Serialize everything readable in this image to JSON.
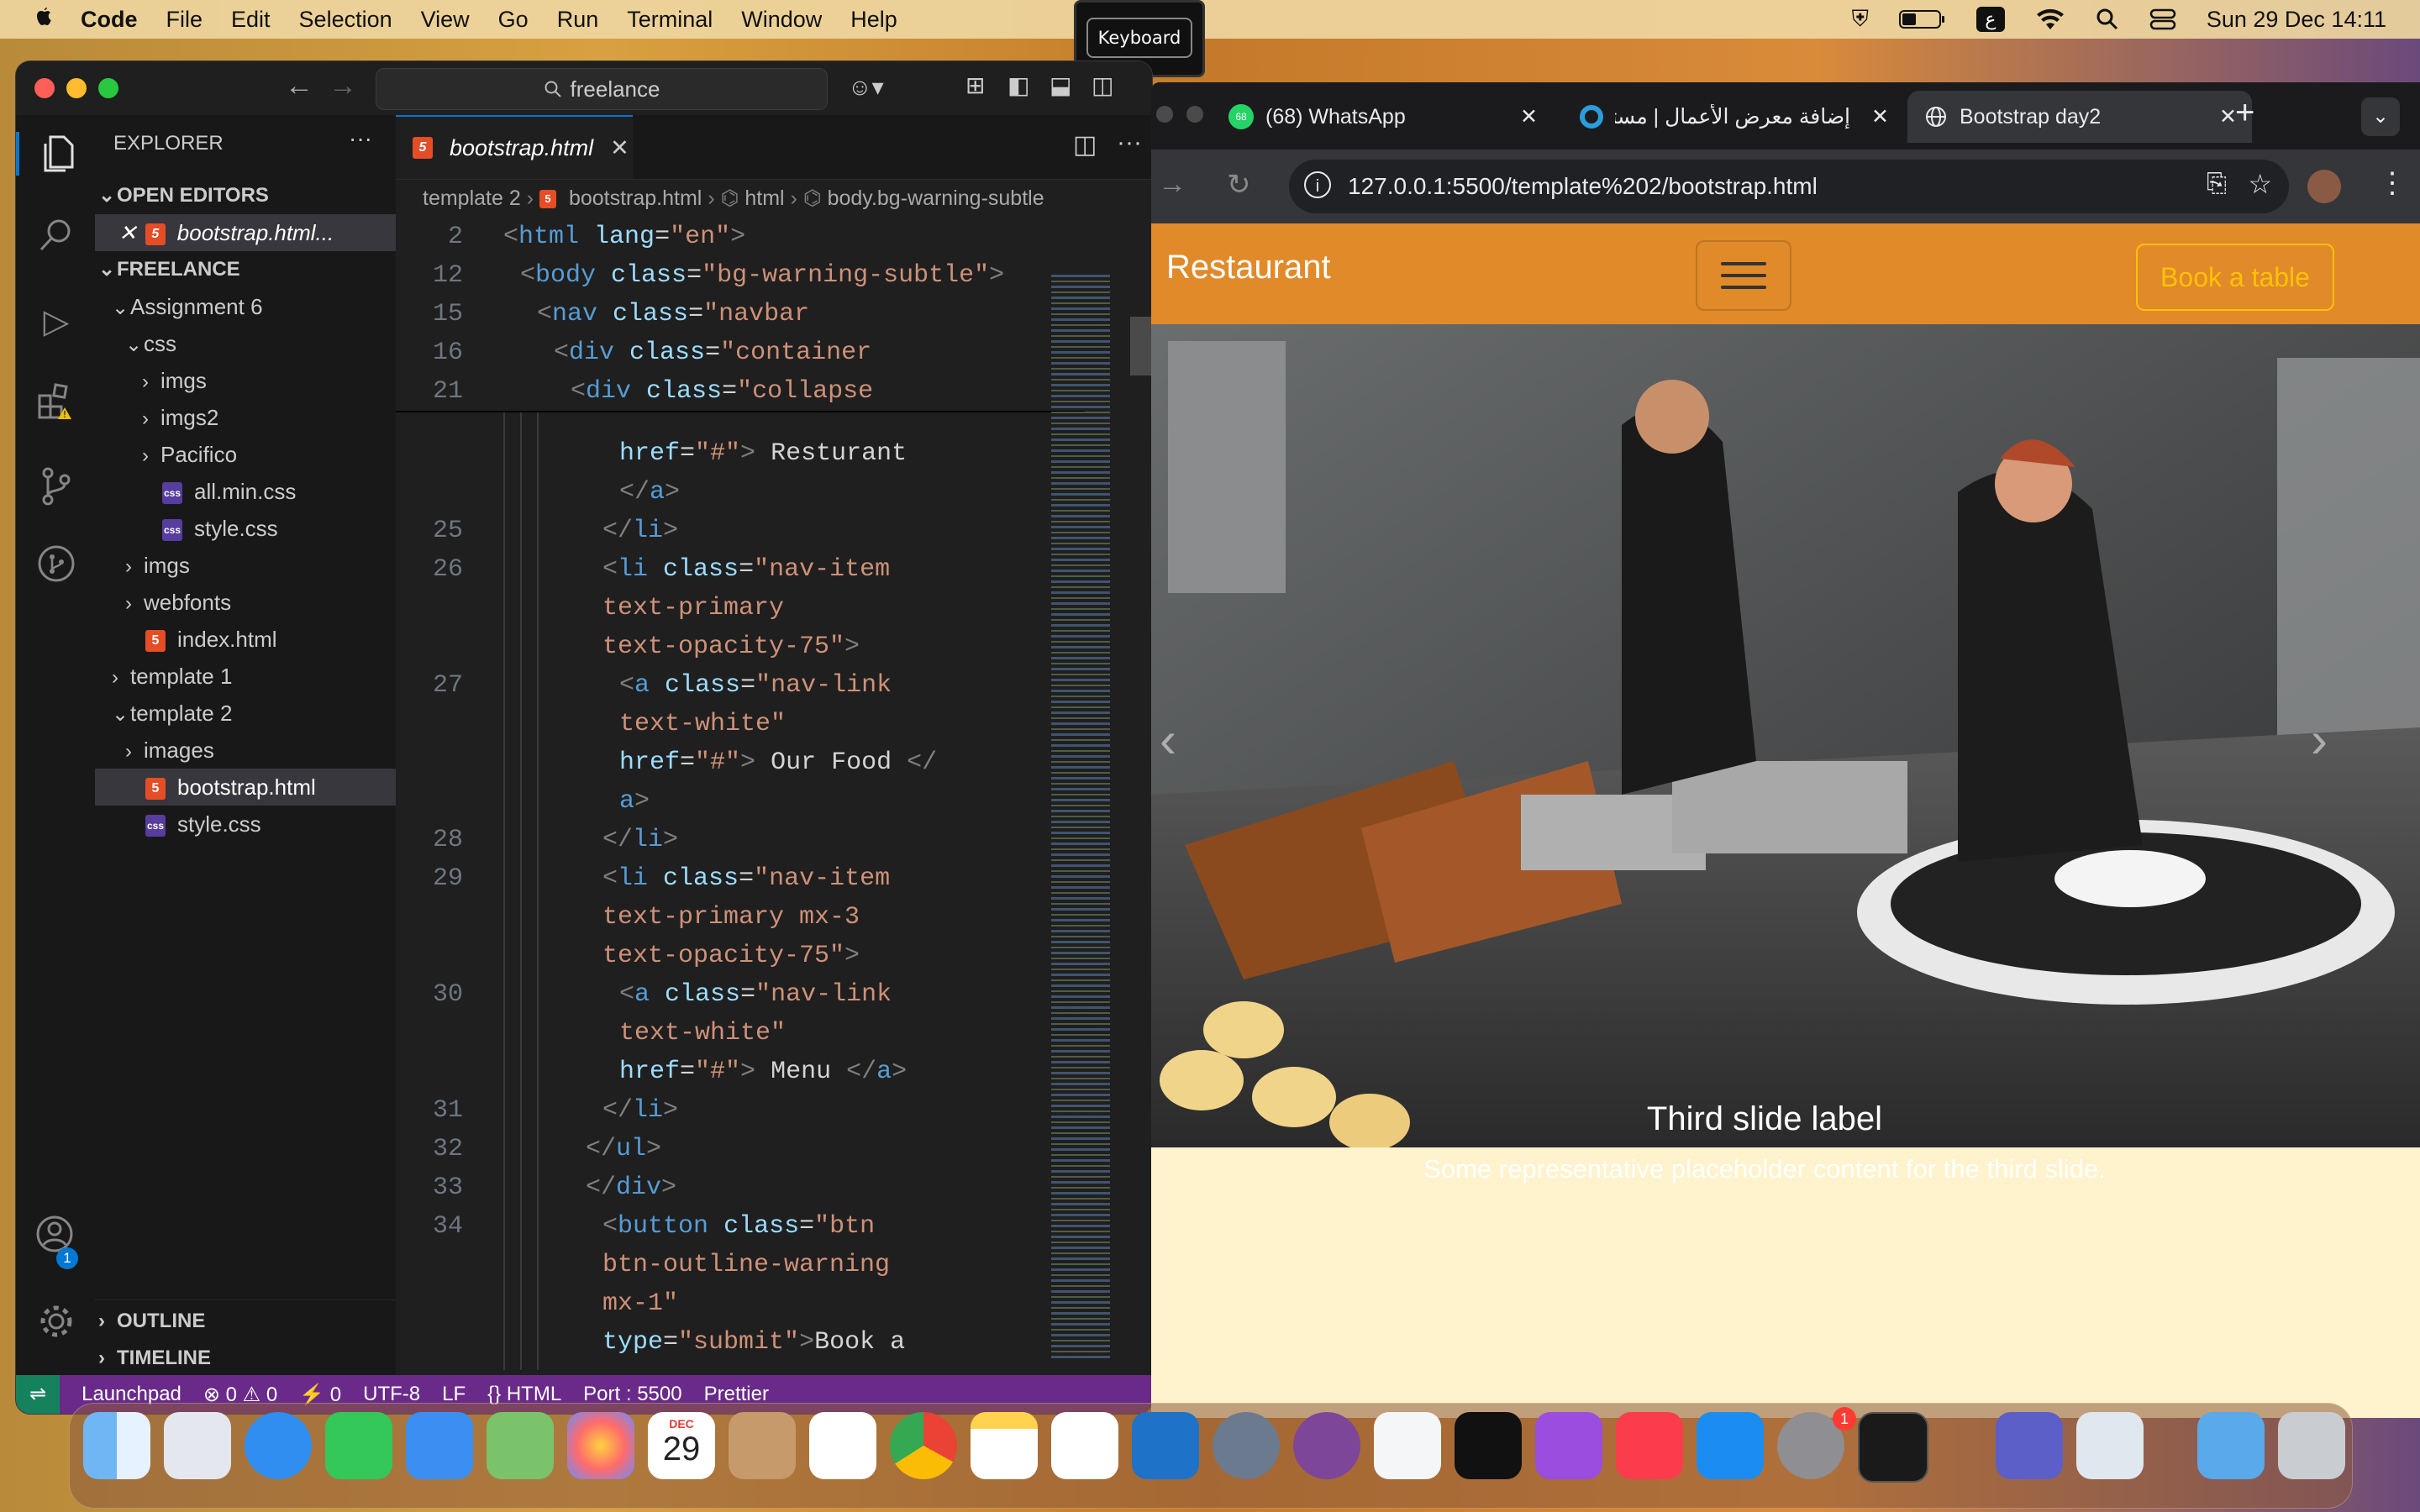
{
  "menubar": {
    "app_name": "Code",
    "items": [
      "File",
      "Edit",
      "Selection",
      "View",
      "Go",
      "Run",
      "Terminal",
      "Window",
      "Help"
    ],
    "keyboard_popup": "Keyboard",
    "datetime": "Sun 29 Dec  14:11"
  },
  "vscode": {
    "search_text": "freelance",
    "explorer_title": "EXPLORER",
    "open_editors_label": "OPEN EDITORS",
    "open_editor_file": "bootstrap.html...",
    "workspace_label": "FREELANCE",
    "tree": [
      "Assignment 6",
      "css",
      "imgs",
      "imgs2",
      "Pacifico",
      "all.min.css",
      "style.css",
      "imgs",
      "webfonts",
      "index.html",
      "template 1",
      "template 2",
      "images",
      "bootstrap.html",
      "style.css"
    ],
    "outline_label": "OUTLINE",
    "timeline_label": "TIMELINE",
    "active_tab": "bootstrap.html",
    "breadcrumb": [
      "template 2",
      "bootstrap.html",
      "html",
      "body.bg-warning-subtle"
    ],
    "line_numbers": [
      "2",
      "12",
      "15",
      "16",
      "21",
      "25",
      "26",
      "27",
      "28",
      "29",
      "30",
      "31",
      "32",
      "33",
      "34"
    ],
    "statusbar": [
      "Launchpad",
      "⊗ 0 ⚠ 0",
      "⚡ 0",
      "UTF-8",
      "LF",
      "{} HTML",
      "Port : 5500",
      "Prettier"
    ],
    "accounts_badge": "1"
  },
  "browser": {
    "tabs": [
      {
        "title": "(68) WhatsApp",
        "badge": "68"
      },
      {
        "title": "إضافة معرض الأعمال | مستقل"
      },
      {
        "title": "Bootstrap day2"
      }
    ],
    "url": "127.0.0.1:5500/template%202/bootstrap.html",
    "page": {
      "brand": "Restaurant",
      "book_button": "Book a table",
      "caption_title": "Third slide label",
      "caption_text": "Some representative placeholder content for the third slide."
    }
  },
  "dock": {
    "calendar_month": "DEC",
    "calendar_day": "29",
    "settings_badge": "1"
  }
}
